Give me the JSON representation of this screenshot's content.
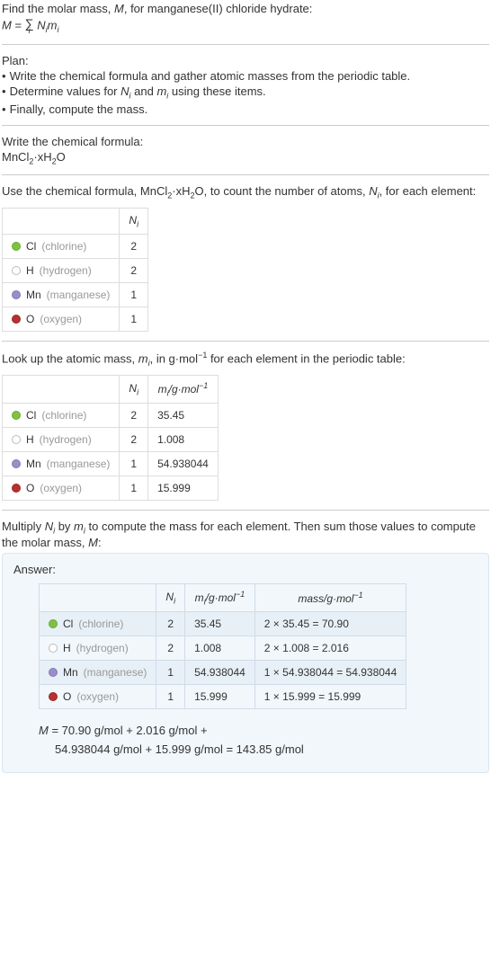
{
  "intro": {
    "line1_pre": "Find the molar mass, ",
    "line1_M": "M",
    "line1_post": ", for manganese(II) chloride hydrate:",
    "eq_M": "M",
    "eq_eq": " = ",
    "sigma": "∑",
    "sigma_under": "i",
    "Ni_N": "N",
    "Ni_i": "i",
    "mi_m": "m",
    "mi_i": "i"
  },
  "plan": {
    "title": "Plan:",
    "b1_pre": "Write the chemical formula and gather atomic masses from the periodic table.",
    "b2_pre": "Determine values for ",
    "b2_Ni_N": "N",
    "b2_Ni_i": "i",
    "b2_mid": " and ",
    "b2_mi_m": "m",
    "b2_mi_i": "i",
    "b2_post": " using these items.",
    "b3": "Finally, compute the mass.",
    "bullet": "•"
  },
  "write_formula": {
    "title": "Write the chemical formula:",
    "Mn": "MnCl",
    "two1": "2",
    "dot": "·",
    "xH": "xH",
    "two2": "2",
    "O": "O"
  },
  "count_section": {
    "pre": "Use the chemical formula, ",
    "Mn": "MnCl",
    "two1": "2",
    "dot": "·",
    "xH": "xH",
    "two2": "2",
    "O": "O",
    "mid": ", to count the number of atoms, ",
    "N": "N",
    "i": "i",
    "post": ", for each element:"
  },
  "table1_header": {
    "Ni_N": "N",
    "Ni_i": "i"
  },
  "elements": [
    {
      "dot": "dot-cl",
      "sym": "Cl",
      "name": "(chlorine)",
      "N": "2",
      "m": "35.45",
      "massExpr": "2 × 35.45 = 70.90"
    },
    {
      "dot": "dot-h",
      "sym": "H",
      "name": "(hydrogen)",
      "N": "2",
      "m": "1.008",
      "massExpr": "2 × 1.008 = 2.016"
    },
    {
      "dot": "dot-mn",
      "sym": "Mn",
      "name": "(manganese)",
      "N": "1",
      "m": "54.938044",
      "massExpr": "1 × 54.938044 = 54.938044"
    },
    {
      "dot": "dot-o",
      "sym": "O",
      "name": "(oxygen)",
      "N": "1",
      "m": "15.999",
      "massExpr": "1 × 15.999 = 15.999"
    }
  ],
  "lookup_section": {
    "pre": "Look up the atomic mass, ",
    "m": "m",
    "i": "i",
    "mid1": ", in g·mol",
    "neg1": "−1",
    "post": " for each element in the periodic table:"
  },
  "table2_header": {
    "Ni_N": "N",
    "Ni_i": "i",
    "mi_m": "m",
    "mi_i": "i",
    "unit_pre": "/g·mol",
    "neg1": "−1"
  },
  "multiply_section": {
    "pre": "Multiply ",
    "N": "N",
    "Ni": "i",
    "mid1": " by ",
    "m": "m",
    "mi": "i",
    "mid2": " to compute the mass for each element. Then sum those values to compute the molar mass, ",
    "M": "M",
    "post": ":"
  },
  "answer": {
    "title": "Answer:",
    "header": {
      "Ni_N": "N",
      "Ni_i": "i",
      "mi_m": "m",
      "mi_i": "i",
      "unit_pre": "/g·mol",
      "neg1": "−1",
      "mass_pre": "mass/g·mol",
      "mass_neg1": "−1"
    },
    "final": {
      "M": "M",
      "line1": " = 70.90 g/mol + 2.016 g/mol + ",
      "line2": "54.938044 g/mol + 15.999 g/mol = 143.85 g/mol"
    }
  }
}
